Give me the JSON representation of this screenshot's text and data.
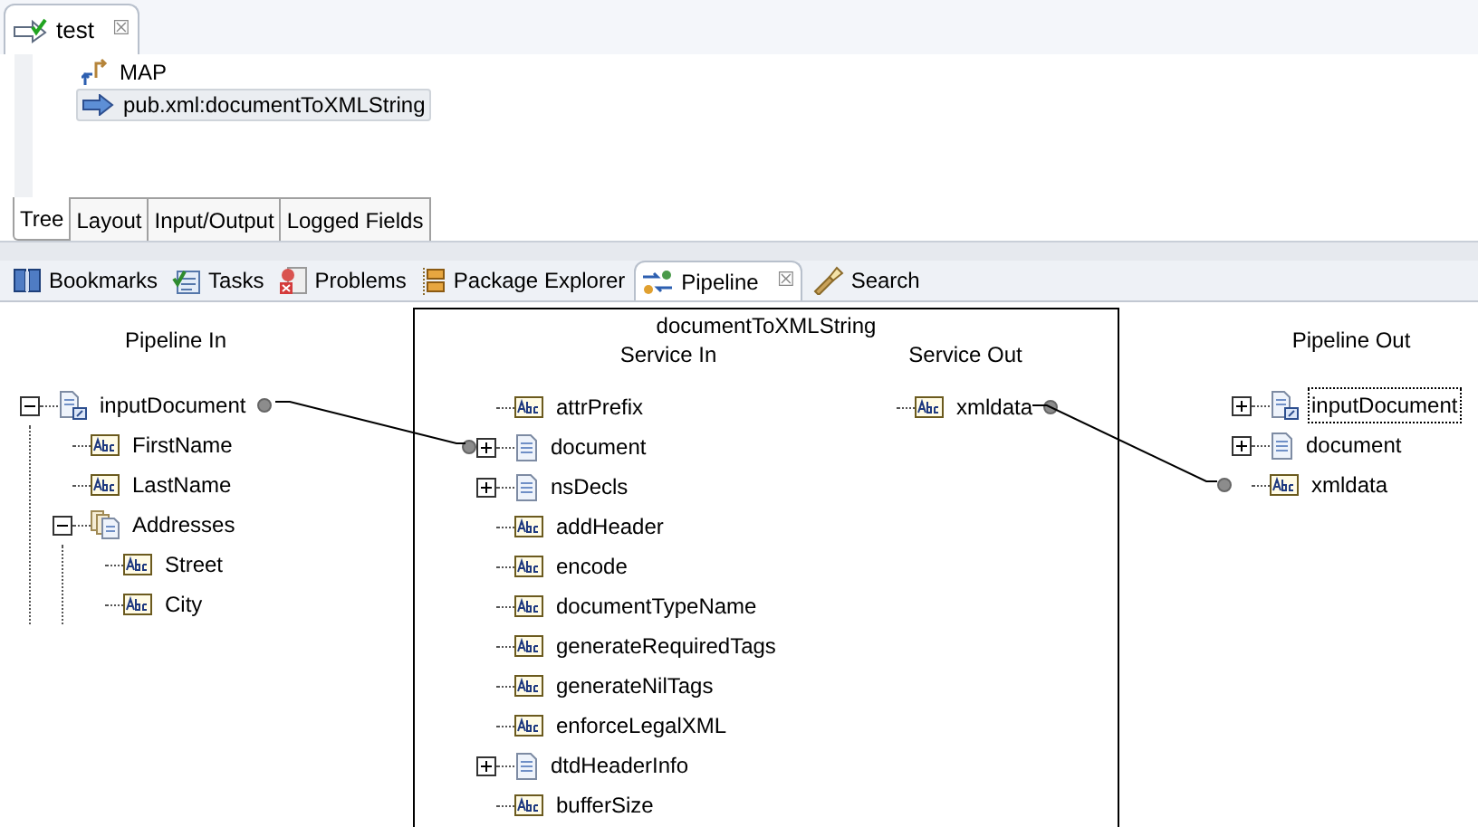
{
  "editor_tab": {
    "title": "test",
    "close": "☒"
  },
  "flow_steps": [
    {
      "kind": "map",
      "label": "MAP",
      "selected": false
    },
    {
      "kind": "invoke",
      "label": "pub.xml:documentToXMLString",
      "selected": true
    }
  ],
  "editor_tabs": [
    {
      "label": "Tree",
      "selected": true
    },
    {
      "label": "Layout",
      "selected": false
    },
    {
      "label": "Input/Output",
      "selected": false
    },
    {
      "label": "Logged Fields",
      "selected": false
    }
  ],
  "view_tabs": [
    {
      "kind": "bookmarks",
      "label": "Bookmarks",
      "selected": false
    },
    {
      "kind": "tasks",
      "label": "Tasks",
      "selected": false
    },
    {
      "kind": "problems",
      "label": "Problems",
      "selected": false
    },
    {
      "kind": "package",
      "label": "Package Explorer",
      "selected": false
    },
    {
      "kind": "pipeline",
      "label": "Pipeline",
      "selected": true,
      "close": "☒"
    },
    {
      "kind": "search",
      "label": "Search",
      "selected": false
    }
  ],
  "pipeline_in": {
    "title": "Pipeline In",
    "items": [
      {
        "kind": "docref",
        "name": "inputDocument",
        "expanded": true,
        "linked": true,
        "children": [
          {
            "kind": "string",
            "name": "FirstName"
          },
          {
            "kind": "string",
            "name": "LastName"
          },
          {
            "kind": "doclist",
            "name": "Addresses",
            "expanded": true,
            "children": [
              {
                "kind": "string",
                "name": "Street"
              },
              {
                "kind": "string",
                "name": "City"
              }
            ]
          }
        ]
      }
    ]
  },
  "service": {
    "title": "documentToXMLString",
    "service_in": {
      "title": "Service In",
      "items": [
        {
          "kind": "string",
          "name": "attrPrefix"
        },
        {
          "kind": "document",
          "name": "document",
          "expanded": false,
          "linked": true
        },
        {
          "kind": "document",
          "name": "nsDecls",
          "expanded": false
        },
        {
          "kind": "string",
          "name": "addHeader"
        },
        {
          "kind": "string",
          "name": "encode"
        },
        {
          "kind": "string",
          "name": "documentTypeName"
        },
        {
          "kind": "string",
          "name": "generateRequiredTags"
        },
        {
          "kind": "string",
          "name": "generateNilTags"
        },
        {
          "kind": "string",
          "name": "enforceLegalXML"
        },
        {
          "kind": "document",
          "name": "dtdHeaderInfo",
          "expanded": false
        },
        {
          "kind": "string",
          "name": "bufferSize"
        }
      ]
    },
    "service_out": {
      "title": "Service Out",
      "items": [
        {
          "kind": "string",
          "name": "xmldata",
          "linked": true
        }
      ]
    }
  },
  "pipeline_out": {
    "title": "Pipeline Out",
    "items": [
      {
        "kind": "docref",
        "name": "inputDocument",
        "expanded": false,
        "selected": true
      },
      {
        "kind": "document",
        "name": "document",
        "expanded": false
      },
      {
        "kind": "string",
        "name": "xmldata",
        "linked": true
      }
    ]
  }
}
